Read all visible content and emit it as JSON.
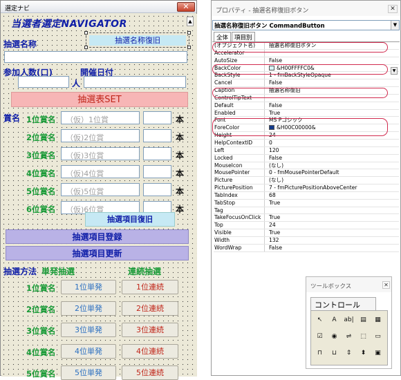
{
  "form": {
    "title": "選定ナビ",
    "close": "✕",
    "heading": "当選者選定NAVIGATOR",
    "lottery_name_label": "抽選名称",
    "restore_name_button": "抽選名称復旧",
    "participants_label": "参加人数(口)",
    "date_label": "開催日付",
    "people_unit": "人",
    "set_button": "抽選表SET",
    "prize_label": "賞名",
    "prize_rows": [
      {
        "label": "1位賞名",
        "placeholder": "（仮）1位賞",
        "unit": "本"
      },
      {
        "label": "2位賞名",
        "placeholder": "（仮)2位賞",
        "unit": "本"
      },
      {
        "label": "3位賞名",
        "placeholder": "（仮)3位賞",
        "unit": "本"
      },
      {
        "label": "4位賞名",
        "placeholder": "（仮)4位賞",
        "unit": "本"
      },
      {
        "label": "5位賞名",
        "placeholder": "（仮)5位賞",
        "unit": "本"
      },
      {
        "label": "6位賞名",
        "placeholder": "（仮)6位賞",
        "unit": "本"
      }
    ],
    "restore_items_button": "抽選項目復旧",
    "register_button": "抽選項目登録",
    "update_button": "抽選項目更新",
    "method_label": "抽選方法",
    "single_label": "単発抽選",
    "continuous_label": "連続抽選",
    "draw_rows": [
      {
        "label": "1位賞名",
        "single": "1位単発",
        "continuous": "1位連続"
      },
      {
        "label": "2位賞名",
        "single": "2位単発",
        "continuous": "2位連続"
      },
      {
        "label": "3位賞名",
        "single": "3位単発",
        "continuous": "3位連続"
      },
      {
        "label": "4位賞名",
        "single": "4位単発",
        "continuous": "4位連続"
      },
      {
        "label": "5位賞名",
        "single": "5位単発",
        "continuous": "5位連続"
      }
    ]
  },
  "properties": {
    "title": "プロパティ - 抽選名称復旧ボタン",
    "close": "✕",
    "object_select": "抽選名称復旧ボタン  CommandButton",
    "tabs": [
      "全体",
      "項目別"
    ],
    "rows": [
      {
        "name": "(オブジェクト名)",
        "value": "抽選名称復旧ボタン"
      },
      {
        "name": "Accelerator",
        "value": ""
      },
      {
        "name": "AutoSize",
        "value": "False"
      },
      {
        "name": "BackColor",
        "value": "&H00FFFFC0&",
        "swatch": "#d8f4f8"
      },
      {
        "name": "BackStyle",
        "value": "1 - fmBackStyleOpaque"
      },
      {
        "name": "Cancel",
        "value": "False"
      },
      {
        "name": "Caption",
        "value": "抽選名称復旧"
      },
      {
        "name": "ControlTipText",
        "value": ""
      },
      {
        "name": "Default",
        "value": "False"
      },
      {
        "name": "Enabled",
        "value": "True"
      },
      {
        "name": "Font",
        "value": "MS Pゴシック"
      },
      {
        "name": "ForeColor",
        "value": "&H00C00000&",
        "swatch": "#123a8a"
      },
      {
        "name": "Height",
        "value": "24"
      },
      {
        "name": "HelpContextID",
        "value": "0"
      },
      {
        "name": "Left",
        "value": "120"
      },
      {
        "name": "Locked",
        "value": "False"
      },
      {
        "name": "MouseIcon",
        "value": "(なし)"
      },
      {
        "name": "MousePointer",
        "value": "0 - fmMousePointerDefault"
      },
      {
        "name": "Picture",
        "value": "(なし)"
      },
      {
        "name": "PicturePosition",
        "value": "7 - fmPicturePositionAboveCenter"
      },
      {
        "name": "TabIndex",
        "value": "68"
      },
      {
        "name": "TabStop",
        "value": "True"
      },
      {
        "name": "Tag",
        "value": ""
      },
      {
        "name": "TakeFocusOnClick",
        "value": "True"
      },
      {
        "name": "Top",
        "value": "24"
      },
      {
        "name": "Visible",
        "value": "True"
      },
      {
        "name": "Width",
        "value": "132"
      },
      {
        "name": "WordWrap",
        "value": "False"
      }
    ]
  },
  "toolbox": {
    "title": "ツールボックス",
    "close": "✕",
    "tab": "コントロール",
    "tools": [
      "select-pointer",
      "label",
      "textbox",
      "combobox",
      "listbox",
      "checkbox",
      "option-button",
      "toggle-button",
      "frame",
      "command-button",
      "tabstrip",
      "multipage",
      "scrollbar",
      "spinbutton",
      "image"
    ],
    "tool_glyphs": [
      "↖",
      "A",
      "ab|",
      "▤",
      "▦",
      "☑",
      "◉",
      "⇌",
      "⬚",
      "▭",
      "⊓",
      "⊔",
      "⇕",
      "⬍",
      "▣"
    ]
  },
  "colors": {
    "heading_blue": "#0f1ea8",
    "prize_green": "#189a36",
    "set_button": "#f7b6b6",
    "restore_button": "#c6e9f4",
    "purple_button": "#b9b2e6",
    "highlight_oval": "#d12a4e"
  }
}
